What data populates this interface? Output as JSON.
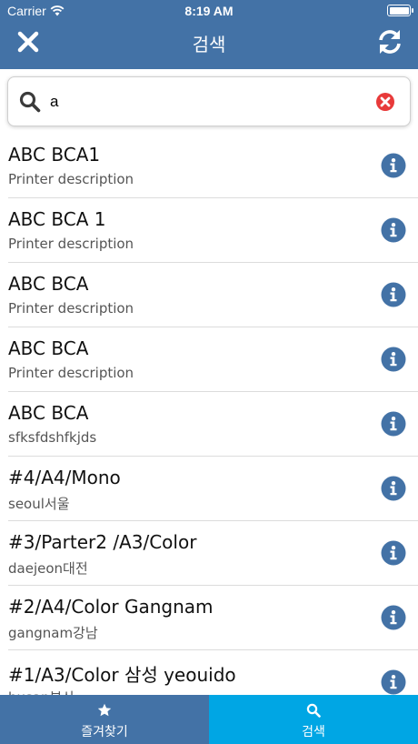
{
  "status_bar": {
    "carrier": "Carrier",
    "time": "8:19 AM"
  },
  "nav": {
    "title": "검색"
  },
  "search": {
    "value": "a"
  },
  "printers": [
    {
      "name": "ABC BCA1",
      "description": "Printer description"
    },
    {
      "name": "ABC BCA 1",
      "description": "Printer description"
    },
    {
      "name": "ABC BCA",
      "description": "Printer description"
    },
    {
      "name": "ABC BCA",
      "description": "Printer description"
    },
    {
      "name": "ABC BCA",
      "description": "sfksfdshfkjds"
    },
    {
      "name": "#4/A4/Mono",
      "description": "seoul서울"
    },
    {
      "name": "#3/Parter2 /A3/Color",
      "description": "daejeon대전"
    },
    {
      "name": "#2/A4/Color Gangnam",
      "description": "gangnam강남"
    },
    {
      "name": "#1/A3/Color 삼성 yeouido",
      "description": "busan부산"
    }
  ],
  "tabs": {
    "favorites": "즐겨찾기",
    "search": "검색"
  },
  "colors": {
    "nav_bar": "#4372a6",
    "tab_active": "#00a6e4",
    "info_icon": "#4372a6",
    "clear_icon": "#e83a3a"
  }
}
